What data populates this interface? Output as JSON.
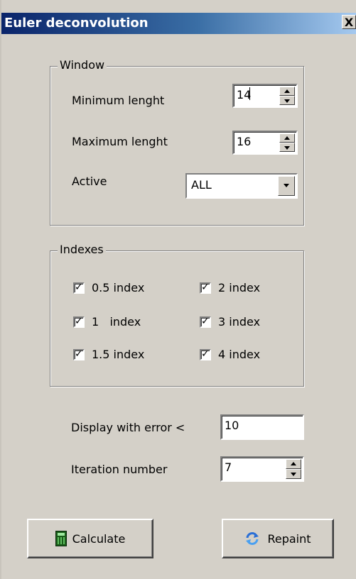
{
  "window": {
    "title": "Euler deconvolution",
    "close_glyph": "X"
  },
  "window_group": {
    "legend": "Window",
    "min_length_label": "Minimum lenght",
    "min_length_value": "14",
    "max_length_label": "Maximum lenght",
    "max_length_value": "16",
    "active_label": "Active",
    "active_value": "ALL"
  },
  "indexes_group": {
    "legend": "Indexes",
    "items": [
      {
        "label": "0.5 index",
        "checked": true
      },
      {
        "label": "2 index",
        "checked": true
      },
      {
        "label": "1   index",
        "checked": true
      },
      {
        "label": "3 index",
        "checked": true
      },
      {
        "label": "1.5 index",
        "checked": true
      },
      {
        "label": "4 index",
        "checked": true
      }
    ]
  },
  "error_label": "Display with error <",
  "error_value": "10",
  "iteration_label": "Iteration number",
  "iteration_value": "7",
  "buttons": {
    "calculate": "Calculate",
    "repaint": "Repaint"
  },
  "icons": {
    "calculate": "calculator-icon",
    "repaint": "refresh-icon",
    "check": "checkmark-icon"
  },
  "colors": {
    "titlebar_start": "#0a246a",
    "titlebar_end": "#a6caf0",
    "dialog_bg": "#d4d0c8"
  }
}
